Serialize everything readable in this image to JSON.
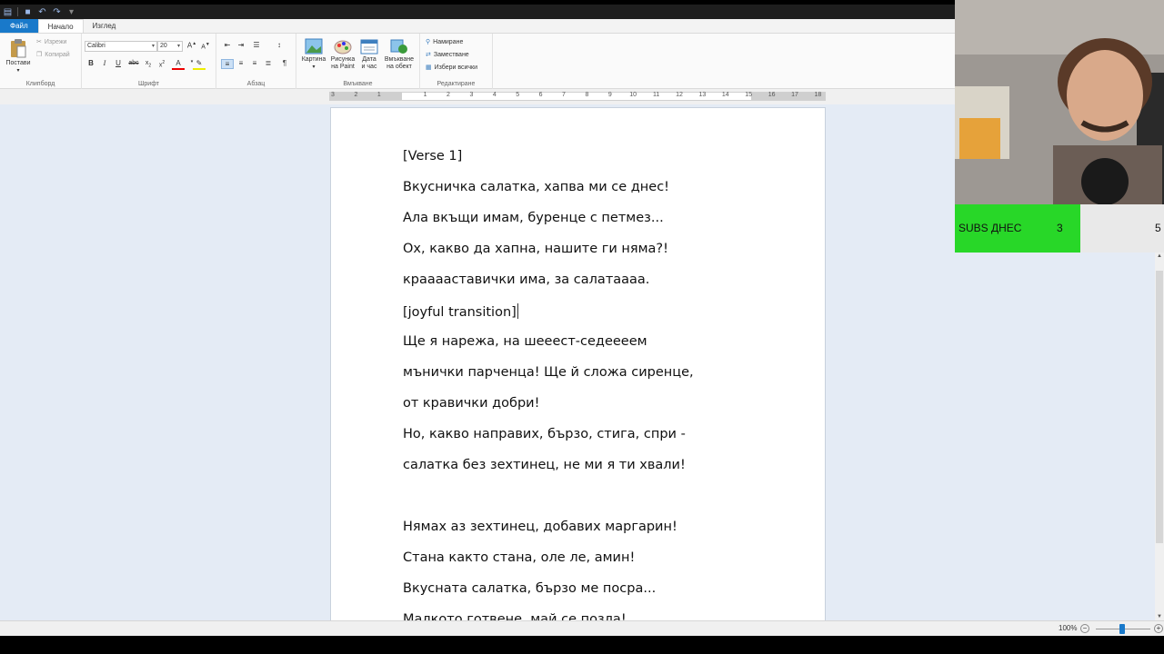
{
  "ribbon": {
    "tabs": [
      "Файл",
      "Начало",
      "Изглед"
    ],
    "clipboard": {
      "paste": "Постави",
      "cut": "Изрежи",
      "copy": "Копирай",
      "group": "Клипборд"
    },
    "font": {
      "family": "Calibri",
      "size": "20",
      "group": "Шрифт"
    },
    "paragraph": {
      "group": "Абзац"
    },
    "insert": {
      "picture": "Картина",
      "paint1": "Рисунка",
      "paint2": "на Paint",
      "date1": "Дата",
      "date2": "и час",
      "object1": "Вмъкване",
      "object2": "на обект",
      "group": "Вмъкване"
    },
    "editing": {
      "find": "Намиране",
      "replace": "Заместване",
      "select_all": "Избери всички",
      "group": "Редактиране"
    }
  },
  "ruler": {
    "ticks": [
      {
        "label": "3",
        "pos": 0
      },
      {
        "label": "2",
        "pos": 1
      },
      {
        "label": "1",
        "pos": 2
      },
      {
        "label": "1",
        "pos": 4
      },
      {
        "label": "2",
        "pos": 5
      },
      {
        "label": "3",
        "pos": 6
      },
      {
        "label": "4",
        "pos": 7
      },
      {
        "label": "5",
        "pos": 8
      },
      {
        "label": "6",
        "pos": 9
      },
      {
        "label": "7",
        "pos": 10
      },
      {
        "label": "8",
        "pos": 11
      },
      {
        "label": "9",
        "pos": 12
      },
      {
        "label": "10",
        "pos": 13
      },
      {
        "label": "11",
        "pos": 14
      },
      {
        "label": "12",
        "pos": 15
      },
      {
        "label": "13",
        "pos": 16
      },
      {
        "label": "14",
        "pos": 17
      },
      {
        "label": "15",
        "pos": 18
      },
      {
        "label": "16",
        "pos": 19
      },
      {
        "label": "17",
        "pos": 20
      },
      {
        "label": "18",
        "pos": 21
      }
    ]
  },
  "document": {
    "lines": [
      "[Verse 1]",
      "Вкусничка салатка, хапва ми се днес!",
      "Ала вкъщи имам, буренце с петмез...",
      "Ох, какво да хапна, нашите ги няма?!",
      "крааааставички има, за салатаааа.",
      "[joyful transition]",
      "Ще я нарежа, на шееест-седеееем",
      "мънички парченца! Ще й сложа сиренце,",
      "от кравички добри!",
      "Но, какво направих, бързо, стига, спри -",
      "салатка без зехтинец, не ми я ти хвали!",
      "",
      "Нямах аз зехтинец, добавих маргарин!",
      "Стана както стана, оле ле, амин!",
      "Вкусната салатка, бързо ме посра...",
      "Малкото готвене, май се позла!"
    ]
  },
  "status": {
    "zoom": "100%"
  },
  "overlay": {
    "subs_label": "SUBS ДНЕС",
    "subs_count": "3",
    "subs_goal": "5",
    "subs_progress": 0.6
  }
}
